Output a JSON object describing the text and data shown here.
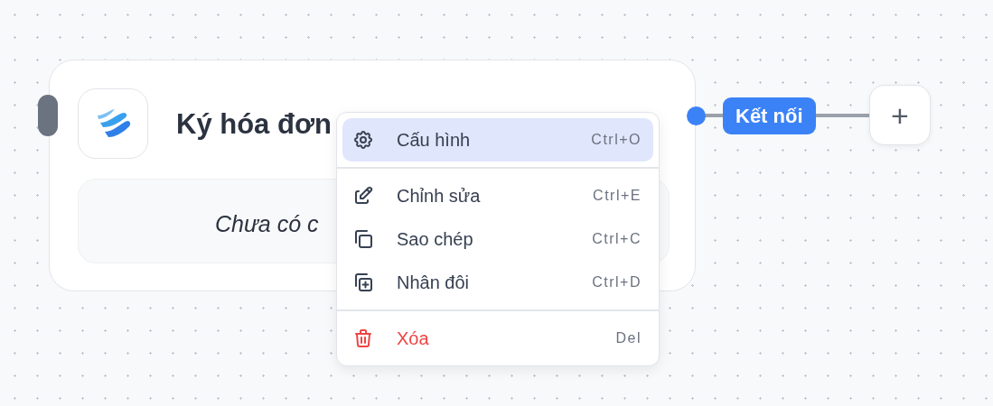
{
  "node": {
    "title": "Ký hóa đơn",
    "subtitle": "Chưa có c"
  },
  "connector": {
    "label": "Kết nối"
  },
  "add_button": {
    "label": "+"
  },
  "context_menu": {
    "sections": [
      [
        {
          "kind": "settings",
          "label": "Cấu hình",
          "shortcut": "Ctrl+O",
          "selected": true,
          "danger": false
        }
      ],
      [
        {
          "kind": "edit",
          "label": "Chỉnh sửa",
          "shortcut": "Ctrl+E",
          "selected": false,
          "danger": false
        },
        {
          "kind": "copy",
          "label": "Sao chép",
          "shortcut": "Ctrl+C",
          "selected": false,
          "danger": false
        },
        {
          "kind": "duplicate",
          "label": "Nhân đôi",
          "shortcut": "Ctrl+D",
          "selected": false,
          "danger": false
        }
      ],
      [
        {
          "kind": "delete",
          "label": "Xóa",
          "shortcut": "Del",
          "selected": false,
          "danger": true
        }
      ]
    ]
  }
}
